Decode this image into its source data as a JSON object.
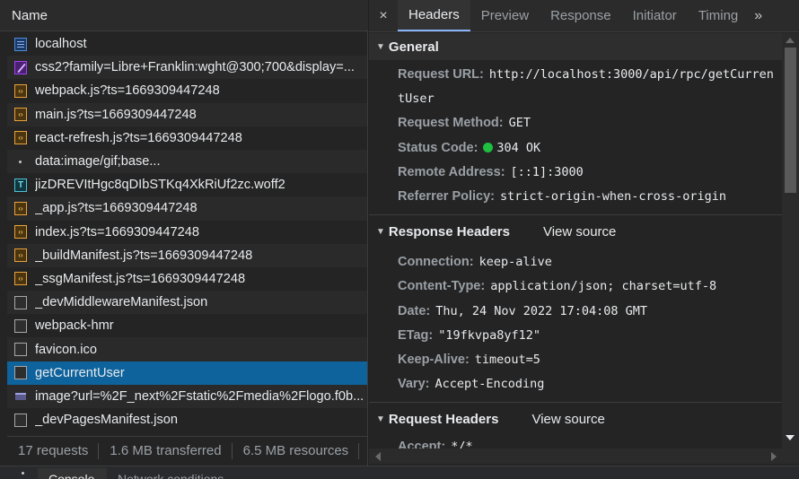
{
  "request_list": {
    "header": "Name",
    "rows": [
      {
        "name": "localhost",
        "icon": "document-icon"
      },
      {
        "name": "css2?family=Libre+Franklin:wght@300;700&display=...",
        "icon": "stylesheet-icon"
      },
      {
        "name": "webpack.js?ts=1669309447248",
        "icon": "script-icon"
      },
      {
        "name": "main.js?ts=1669309447248",
        "icon": "script-icon"
      },
      {
        "name": "react-refresh.js?ts=1669309447248",
        "icon": "script-icon"
      },
      {
        "name": "data:image/gif;base...",
        "icon": "data-uri-icon"
      },
      {
        "name": "jizDREVItHgc8qDIbSTKq4XkRiUf2zc.woff2",
        "icon": "font-icon"
      },
      {
        "name": "_app.js?ts=1669309447248",
        "icon": "script-icon"
      },
      {
        "name": "index.js?ts=1669309447248",
        "icon": "script-icon"
      },
      {
        "name": "_buildManifest.js?ts=1669309447248",
        "icon": "script-icon"
      },
      {
        "name": "_ssgManifest.js?ts=1669309447248",
        "icon": "script-icon"
      },
      {
        "name": "_devMiddlewareManifest.json",
        "icon": "file-icon"
      },
      {
        "name": "webpack-hmr",
        "icon": "file-icon"
      },
      {
        "name": "favicon.ico",
        "icon": "file-icon"
      },
      {
        "name": "getCurrentUser",
        "icon": "file-icon"
      },
      {
        "name": "image?url=%2F_next%2Fstatic%2Fmedia%2Flogo.f0b...",
        "icon": "image-icon"
      },
      {
        "name": "_devPagesManifest.json",
        "icon": "file-icon"
      }
    ],
    "selected": "getCurrentUser",
    "footer": {
      "requests": "17 requests",
      "transferred": "1.6 MB transferred",
      "resources": "6.5 MB resources",
      "truncated": "F"
    }
  },
  "tabs": {
    "close": "×",
    "items": [
      "Headers",
      "Preview",
      "Response",
      "Initiator",
      "Timing"
    ],
    "active": "Headers",
    "more": "»"
  },
  "general": {
    "title": "General",
    "request_url_label": "Request URL:",
    "request_url": "http://localhost:3000/api/rpc/getCurrentUser",
    "request_method_label": "Request Method:",
    "request_method": "GET",
    "status_code_label": "Status Code:",
    "status_code": "304 OK",
    "status_color": "#1fbf3f",
    "remote_address_label": "Remote Address:",
    "remote_address": "[::1]:3000",
    "referrer_policy_label": "Referrer Policy:",
    "referrer_policy": "strict-origin-when-cross-origin"
  },
  "response_headers": {
    "title": "Response Headers",
    "view_source": "View source",
    "items": [
      {
        "k": "Connection:",
        "v": "keep-alive"
      },
      {
        "k": "Content-Type:",
        "v": "application/json; charset=utf-8"
      },
      {
        "k": "Date:",
        "v": "Thu, 24 Nov 2022 17:04:08 GMT"
      },
      {
        "k": "ETag:",
        "v": "\"19fkvpa8yf12\""
      },
      {
        "k": "Keep-Alive:",
        "v": "timeout=5"
      },
      {
        "k": "Vary:",
        "v": "Accept-Encoding"
      }
    ]
  },
  "request_headers": {
    "title": "Request Headers",
    "view_source": "View source",
    "items": [
      {
        "k": "Accept:",
        "v": "*/*"
      }
    ]
  },
  "drawer": {
    "tabs": [
      "Console",
      "Network conditions"
    ]
  },
  "colors": {
    "selected_row": "#0e639c",
    "accent": "#8ab4f8"
  }
}
